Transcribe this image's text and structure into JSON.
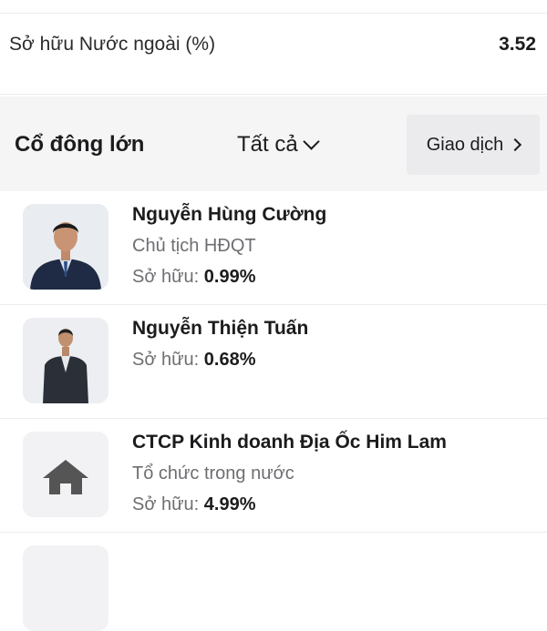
{
  "foreign_ownership": {
    "label": "Sở hữu Nước ngoài (%)",
    "value": "3.52"
  },
  "shareholders": {
    "title": "Cổ đông lớn",
    "filter_label": "Tất cả",
    "transactions_label": "Giao dịch",
    "ownership_prefix": "Sở hữu:",
    "items": [
      {
        "name": "Nguyễn Hùng Cường",
        "role": "Chủ tịch HĐQT",
        "ownership": "0.99%",
        "avatar": "person-photo"
      },
      {
        "name": "Nguyễn Thiện Tuấn",
        "role": "",
        "ownership": "0.68%",
        "avatar": "person-photo"
      },
      {
        "name": "CTCP Kinh doanh Địa Ốc Him Lam",
        "role": "Tổ chức trong nước",
        "ownership": "4.99%",
        "avatar": "home-icon"
      }
    ]
  },
  "colors": {
    "header_bg": "#f5f5f6",
    "button_bg": "#ebebed",
    "muted_text": "#6e6e73"
  }
}
